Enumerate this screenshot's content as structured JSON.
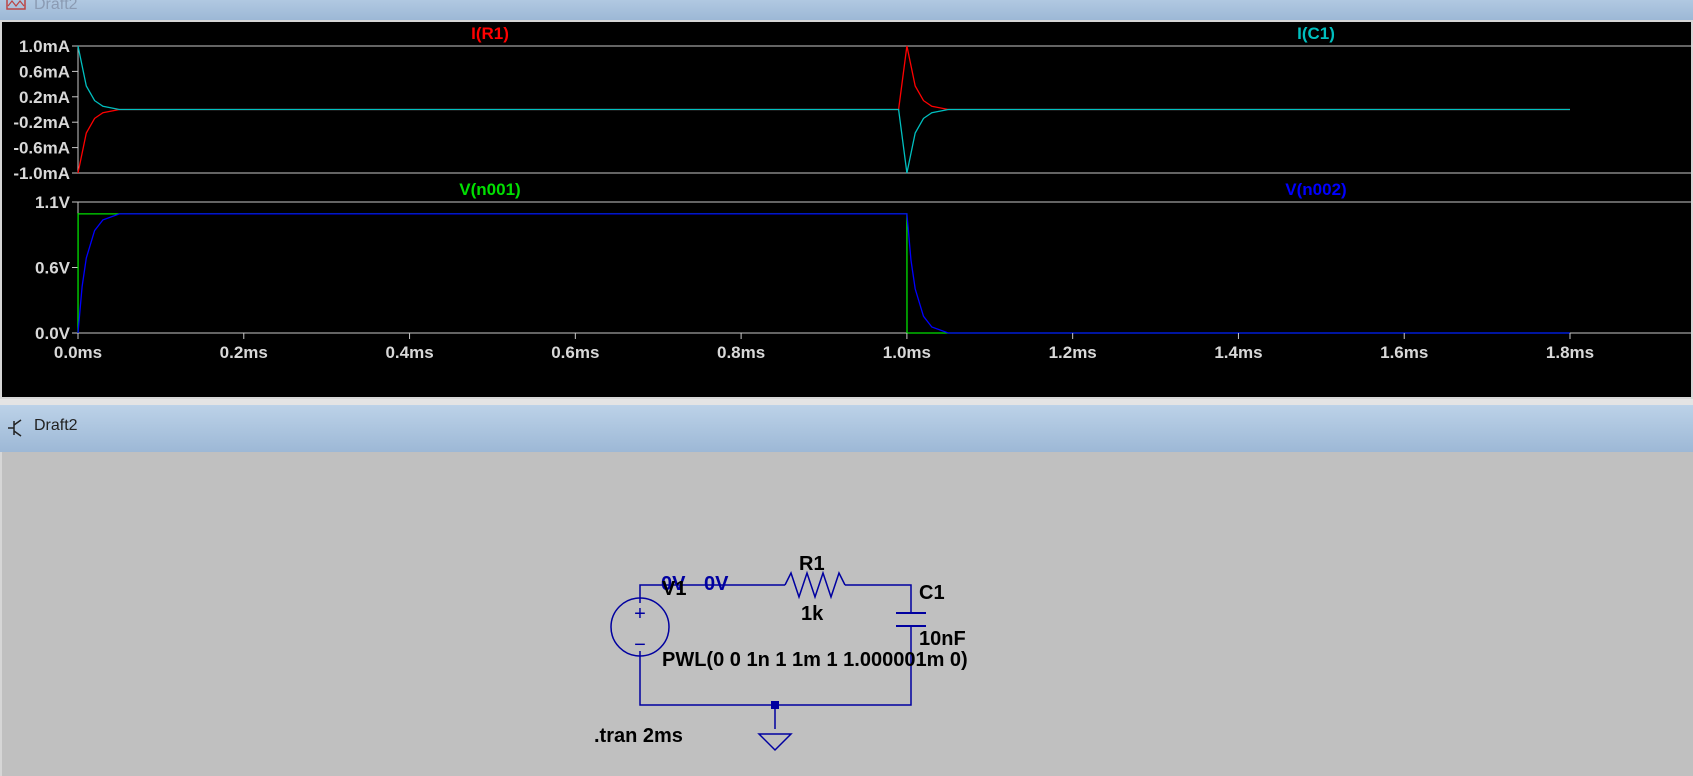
{
  "windows": {
    "waveform_title": "Draft2",
    "schematic_title": "Draft2"
  },
  "icons": {
    "waveform": "waveform-window-icon",
    "schematic": "transistor-schematic-icon"
  },
  "colors": {
    "trace_ir1": "#ff0000",
    "trace_ic1": "#00bfbf",
    "trace_vn001": "#00e000",
    "trace_vn002": "#0000ff",
    "axis": "#c8c8c8",
    "wire": "#0000a0"
  },
  "waveform": {
    "top_pane": {
      "trace_labels": [
        "I(R1)",
        "I(C1)"
      ],
      "y_ticks": [
        "1.0mA",
        "0.6mA",
        "0.2mA",
        "-0.2mA",
        "-0.6mA",
        "-1.0mA"
      ]
    },
    "bottom_pane": {
      "trace_labels": [
        "V(n001)",
        "V(n002)"
      ],
      "y_ticks": [
        "1.1V",
        "0.6V",
        "0.0V"
      ]
    },
    "x_ticks": [
      "0.0ms",
      "0.2ms",
      "0.4ms",
      "0.6ms",
      "0.8ms",
      "1.0ms",
      "1.2ms",
      "1.4ms",
      "1.6ms",
      "1.8ms"
    ]
  },
  "chart_data": [
    {
      "type": "line",
      "x_unit": "ms",
      "y_unit": "mA",
      "xlim": [
        0,
        1.8
      ],
      "ylim": [
        -1.0,
        1.0
      ],
      "series": [
        {
          "name": "I(R1)",
          "x": [
            0,
            0.01,
            0.02,
            0.03,
            0.05,
            0.99,
            1.0,
            1.01,
            1.02,
            1.03,
            1.05,
            1.8
          ],
          "values": [
            -1.0,
            -0.37,
            -0.14,
            -0.05,
            0.0,
            0.0,
            1.0,
            0.37,
            0.14,
            0.05,
            0.0,
            0.0
          ]
        },
        {
          "name": "I(C1)",
          "x": [
            0,
            0.01,
            0.02,
            0.03,
            0.05,
            0.99,
            1.0,
            1.01,
            1.02,
            1.03,
            1.05,
            1.8
          ],
          "values": [
            1.0,
            0.37,
            0.14,
            0.05,
            0.0,
            0.0,
            -1.0,
            -0.37,
            -0.14,
            -0.05,
            0.0,
            0.0
          ]
        }
      ]
    },
    {
      "type": "line",
      "x_unit": "ms",
      "y_unit": "V",
      "xlim": [
        0,
        1.8
      ],
      "ylim": [
        0.0,
        1.1
      ],
      "series": [
        {
          "name": "V(n001)",
          "x": [
            0,
            0.0001,
            1.0,
            1.0001,
            1.8
          ],
          "values": [
            0,
            1.0,
            1.0,
            0,
            0
          ]
        },
        {
          "name": "V(n002)",
          "x": [
            0,
            0.005,
            0.01,
            0.02,
            0.03,
            0.05,
            1.0,
            1.005,
            1.01,
            1.02,
            1.03,
            1.05,
            1.8
          ],
          "values": [
            0,
            0.39,
            0.63,
            0.86,
            0.95,
            1.0,
            1.0,
            0.61,
            0.37,
            0.14,
            0.05,
            0.0,
            0.0
          ]
        }
      ]
    }
  ],
  "schematic": {
    "source_name": "V1",
    "source_plus": "+",
    "source_minus": "−",
    "source_value": "PWL(0 0 1n 1 1m 1 1.000001m 0)",
    "node_labels": [
      "0V",
      "0V"
    ],
    "resistor_name": "R1",
    "resistor_value": "1k",
    "capacitor_name": "C1",
    "capacitor_value": "10nF",
    "directive": ".tran 2ms"
  }
}
